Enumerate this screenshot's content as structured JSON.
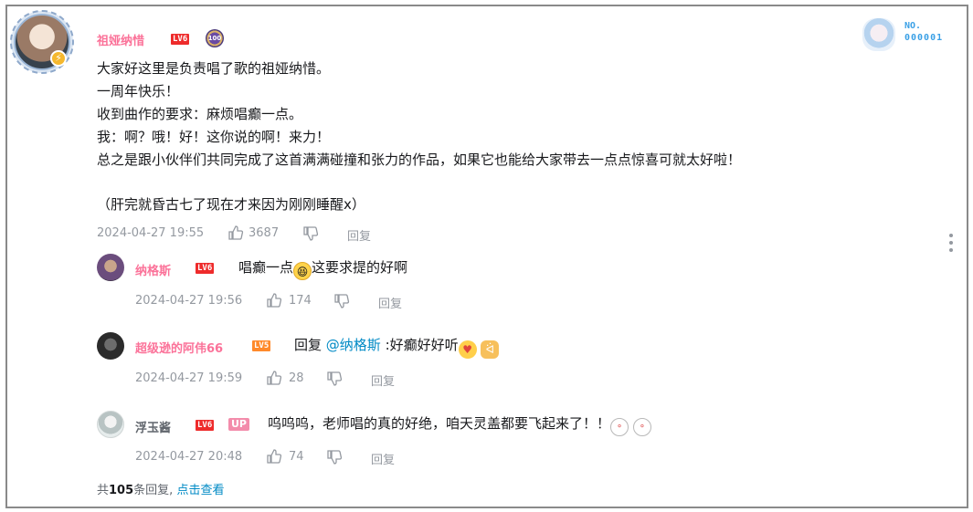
{
  "main_comment": {
    "username": "祖娅纳惜",
    "level": "LV6",
    "medal_text": "100",
    "card_line1": "NO.",
    "card_line2": "000001",
    "lines": [
      "大家好这里是负责唱了歌的祖娅纳惜。",
      "一周年快乐！",
      "收到曲作的要求：麻烦唱癫一点。",
      "我：啊？哦！好！这你说的啊！来力！",
      "总之是跟小伙伴们共同完成了这首满满碰撞和张力的作品，如果它也能给大家带去一点点惊喜可就太好啦！",
      "（肝完就昏古七了现在才来因为刚刚睡醒x）"
    ],
    "time": "2024-04-27 19:55",
    "likes": "3687",
    "reply_label": "回复"
  },
  "replies": [
    {
      "username": "纳格斯",
      "level": "LV6",
      "text_before": "唱癫一点",
      "text_after": "这要求提的好啊",
      "time": "2024-04-27 19:56",
      "likes": "174",
      "reply_label": "回复"
    },
    {
      "username": "超级逊的阿伟66",
      "level": "LV5",
      "reply_prefix": "回复 ",
      "mention": "@纳格斯",
      "text": " :好癫好好听",
      "time": "2024-04-27 19:59",
      "likes": "28",
      "reply_label": "回复"
    },
    {
      "username": "浮玉酱",
      "level": "LV6",
      "up_tag": "UP",
      "text": "呜呜呜，老师唱的真的好绝，咱天灵盖都要飞起来了！！",
      "time": "2024-04-27 20:48",
      "likes": "74",
      "reply_label": "回复"
    }
  ],
  "footer": {
    "prefix": "共",
    "count": "105",
    "suffix": "条回复,",
    "link": "点击查看"
  },
  "colors": {
    "username_pink": "#fb7299",
    "link_blue": "#008ac5",
    "meta_gray": "#9499a0",
    "level6_red": "#ee2b2b",
    "level5_orange": "#ff8a2b"
  }
}
